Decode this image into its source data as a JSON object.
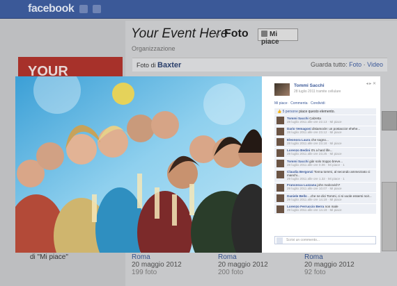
{
  "app": {
    "brand": "facebook"
  },
  "event": {
    "title": "Your Event Here",
    "breadcrumb_sep": "▸",
    "section": "Foto",
    "like_label": "Mi piace",
    "type_label": "Organizzazione"
  },
  "photo_bar": {
    "prefix": "Foto di",
    "owner": "Baxter",
    "view_all_prefix": "Guarda tutto:",
    "view_all_photo": "Foto",
    "view_all_sep": "·",
    "view_all_video": "Video"
  },
  "promo": {
    "text": "YOUR"
  },
  "likes_note": "di \"Mi piace\"",
  "albums": [
    {
      "place": "Roma",
      "date": "20 maggio 2012",
      "count": "199 foto"
    },
    {
      "place": "Roma",
      "date": "20 maggio 2012",
      "count": "200 foto"
    },
    {
      "place": "Roma",
      "date": "20 maggio 2012",
      "count": "92 foto"
    }
  ],
  "lightbox": {
    "author": "Tommi Sacchi",
    "timestamp": "28 luglio 2011 tramite cellulare",
    "controls": "◂ ▸  ✕",
    "actions": {
      "like": "Mi piace",
      "comment": "Commenta",
      "share": "Condividi",
      "sep": "·"
    },
    "likes_count": "5 persone",
    "likes_suffix": "piace questo elemento.",
    "comments": [
      {
        "name": "Tommi Sacchi",
        "text": "Calzetta",
        "meta": "28 luglio 2011 alle ore 22.13 · Mi piace"
      },
      {
        "name": "Dario Vemagoni",
        "text": "disiamocle: un postaccio! ehehe...",
        "meta": "28 luglio 2011 alle ore 23.12 · Mi piace"
      },
      {
        "name": "Eleonora Laura",
        "text": "che sogno...",
        "meta": "28 luglio 2011 alle ore 23.18 · Mi piace"
      },
      {
        "name": "Lorenzo Bedini",
        "text": "It's a hard life...",
        "meta": "28 luglio 2011 alle ore 23.25 · Mi piace"
      },
      {
        "name": "Tommi Sacchi",
        "text": "già! solo troppo breve...",
        "meta": "28 luglio 2011 alle ore 0.06 · Mi piace · 1"
      },
      {
        "name": "Claudia Bergonzi",
        "text": "Tonna tommi, al secondo ammezzato ci manchi...",
        "meta": "29 luglio 2011 alle ore 1.32 · Mi piace · 1"
      },
      {
        "name": "Francesca Luzzana",
        "text": "john malcovich?",
        "meta": "29 luglio 2011 alle ore 10.07 · Mi piace"
      },
      {
        "name": "Daniele Bello",
        "text": "...che ne dici Tommi, ci si vuole essersi noi!...",
        "meta": "29 luglio 2011 alle ore 14.19 · Mi piace"
      },
      {
        "name": "Lorenzo Ferruccio Berra",
        "text": "non male",
        "meta": "29 luglio 2011 alle ore 14.19 · Mi piace"
      }
    ],
    "comment_placeholder": "Scrivi un commento..."
  },
  "colors": {
    "fb_blue": "#3b5998",
    "promo_red": "#a7312a"
  }
}
